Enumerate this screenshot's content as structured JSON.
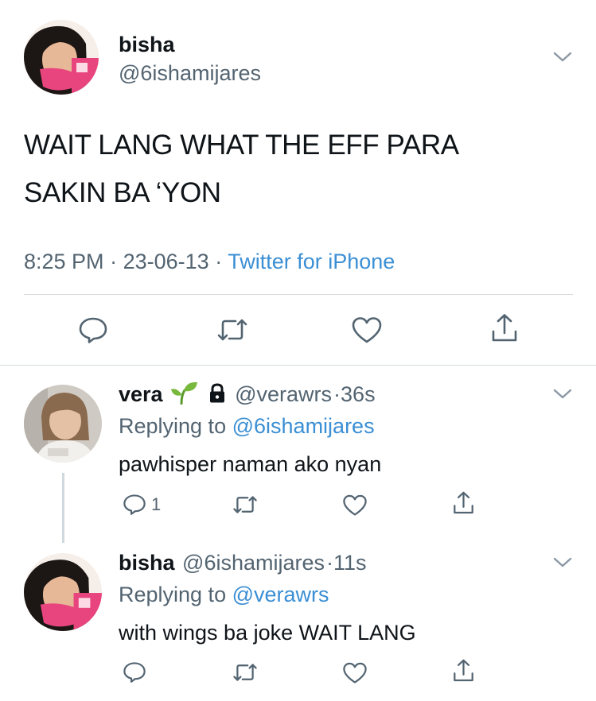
{
  "main_tweet": {
    "display_name": "bisha",
    "handle": "@6ishamijares",
    "text_line1": "WAIT LANG WHAT THE EFF PARA",
    "text_line2": "SAKIN BA ‘YON",
    "time": "8:25 PM",
    "sep1": "·",
    "date": "23-06-13",
    "sep2": "·",
    "source": "Twitter for iPhone",
    "icons": [
      "chevron-down-icon",
      "reply-icon",
      "retweet-icon",
      "like-icon",
      "share-icon"
    ]
  },
  "replies": [
    {
      "display_name": "vera",
      "name_emoji": "seedling",
      "protected": true,
      "handle": "@verawrs",
      "sep": "·",
      "time_ago": "36s",
      "replying_label": "Replying to",
      "replying_to": "@6ishamijares",
      "text": "pawhisper naman ako nyan",
      "reply_count": "1"
    },
    {
      "display_name": "bisha",
      "handle": "@6ishamijares",
      "sep": "·",
      "time_ago": "11s",
      "replying_label": "Replying to",
      "replying_to": "@verawrs",
      "text": "with wings ba joke WAIT LANG",
      "reply_count": ""
    }
  ],
  "colors": {
    "link": "#3b8fd4",
    "secondary_text": "#536471",
    "divider": "#d6dadd",
    "avatar_pink": "#e8457e"
  }
}
